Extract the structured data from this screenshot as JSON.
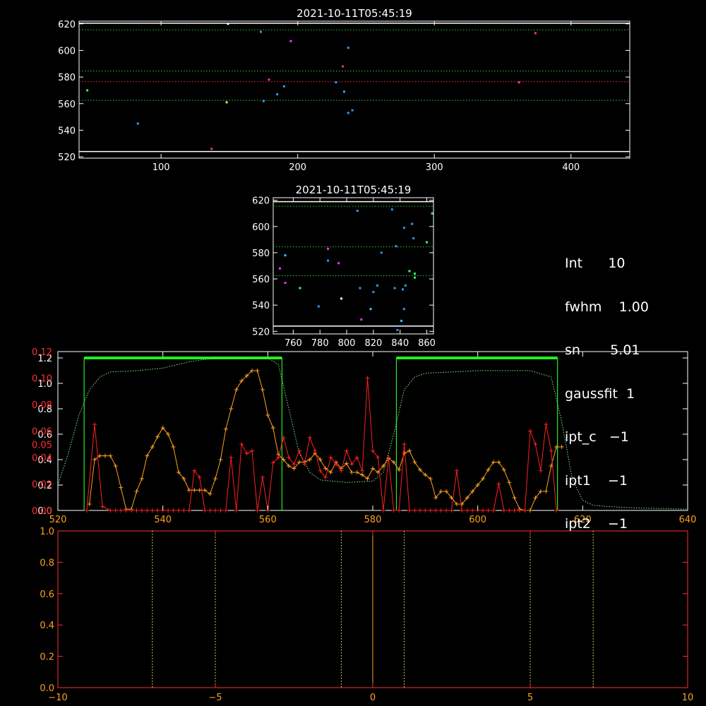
{
  "info_lines": [
    "Int      10",
    "fwhm    1.00",
    "sn       5.01",
    "gaussfit  1",
    "ipt_c   −1",
    "ipt1    −1",
    "ipt2    −1"
  ],
  "chart_data": [
    {
      "type": "scatter",
      "title": "2021-10-11T05:45:19",
      "xlim": [
        40,
        443
      ],
      "ylim": [
        519,
        622
      ],
      "xticks": [
        100,
        200,
        300,
        400
      ],
      "yticks": [
        520,
        540,
        560,
        580,
        600,
        620
      ],
      "hlines": [
        {
          "y": 524,
          "color": "#ffffff",
          "style": "solid"
        },
        {
          "y": 562.5,
          "color": "#2ecc40",
          "style": "dotted"
        },
        {
          "y": 576.5,
          "color": "#ff3030",
          "style": "dotted"
        },
        {
          "y": 584.5,
          "color": "#2ecc40",
          "style": "dotted"
        },
        {
          "y": 615.5,
          "color": "#2ecc40",
          "style": "dotted"
        },
        {
          "y": 620.5,
          "color": "#ffffff",
          "style": "solid"
        }
      ],
      "points": [
        {
          "x": 46,
          "y": 570,
          "color": "#33ff66"
        },
        {
          "x": 83,
          "y": 545,
          "color": "#3399ff"
        },
        {
          "x": 137,
          "y": 526,
          "color": "#ff3366"
        },
        {
          "x": 148,
          "y": 561,
          "color": "#aaff66"
        },
        {
          "x": 149,
          "y": 620,
          "color": "#ffffff"
        },
        {
          "x": 173,
          "y": 614,
          "color": "#3399ff"
        },
        {
          "x": 175,
          "y": 562,
          "color": "#33aaff"
        },
        {
          "x": 179,
          "y": 578,
          "color": "#ff3399"
        },
        {
          "x": 185,
          "y": 567,
          "color": "#3399ff"
        },
        {
          "x": 190,
          "y": 573,
          "color": "#3399ff"
        },
        {
          "x": 195,
          "y": 607,
          "color": "#ff33ff"
        },
        {
          "x": 228,
          "y": 576,
          "color": "#3399ff"
        },
        {
          "x": 233,
          "y": 588,
          "color": "#ff3366"
        },
        {
          "x": 234,
          "y": 569,
          "color": "#33aaff"
        },
        {
          "x": 237,
          "y": 602,
          "color": "#3399ff"
        },
        {
          "x": 237,
          "y": 553,
          "color": "#3399ff"
        },
        {
          "x": 240,
          "y": 555,
          "color": "#3399ff"
        },
        {
          "x": 362,
          "y": 576,
          "color": "#ff3399"
        },
        {
          "x": 374,
          "y": 613,
          "color": "#ff3399"
        }
      ]
    },
    {
      "type": "scatter",
      "title": "2021-10-11T05:45:19",
      "xlim": [
        745,
        865
      ],
      "ylim": [
        518,
        622
      ],
      "xticks": [
        760,
        780,
        800,
        820,
        840,
        860
      ],
      "yticks": [
        520,
        540,
        560,
        580,
        600,
        620
      ],
      "hlines": [
        {
          "y": 524,
          "color": "#ffffff",
          "style": "solid"
        },
        {
          "y": 562.5,
          "color": "#2ecc40",
          "style": "dotted"
        },
        {
          "y": 584.5,
          "color": "#2ecc40",
          "style": "dotted"
        },
        {
          "y": 615.5,
          "color": "#2ecc40",
          "style": "dotted"
        },
        {
          "y": 619,
          "color": "#ffffff",
          "style": "solid"
        }
      ],
      "points": [
        {
          "x": 750,
          "y": 568,
          "color": "#ff33ff"
        },
        {
          "x": 754,
          "y": 578,
          "color": "#33ccff"
        },
        {
          "x": 754,
          "y": 557,
          "color": "#ff33ff"
        },
        {
          "x": 765,
          "y": 553,
          "color": "#33ff66"
        },
        {
          "x": 779,
          "y": 539,
          "color": "#3399ff"
        },
        {
          "x": 786,
          "y": 583,
          "color": "#ff33ff"
        },
        {
          "x": 786,
          "y": 574,
          "color": "#3399ff"
        },
        {
          "x": 794,
          "y": 572,
          "color": "#ff33ff"
        },
        {
          "x": 796,
          "y": 545,
          "color": "#ffffff"
        },
        {
          "x": 808,
          "y": 612,
          "color": "#3399ff"
        },
        {
          "x": 810,
          "y": 553,
          "color": "#3399ff"
        },
        {
          "x": 811,
          "y": 529,
          "color": "#ff33ff"
        },
        {
          "x": 818,
          "y": 537,
          "color": "#33ccff"
        },
        {
          "x": 820,
          "y": 550,
          "color": "#3399ff"
        },
        {
          "x": 823,
          "y": 555,
          "color": "#3399ff"
        },
        {
          "x": 826,
          "y": 580,
          "color": "#3399ff"
        },
        {
          "x": 834,
          "y": 613,
          "color": "#3399ff"
        },
        {
          "x": 836,
          "y": 553,
          "color": "#3399ff"
        },
        {
          "x": 837,
          "y": 585,
          "color": "#3399ff"
        },
        {
          "x": 838,
          "y": 521,
          "color": "#3399ff"
        },
        {
          "x": 841,
          "y": 528,
          "color": "#33ccff"
        },
        {
          "x": 842,
          "y": 552,
          "color": "#3399ff"
        },
        {
          "x": 843,
          "y": 599,
          "color": "#3399ff"
        },
        {
          "x": 843,
          "y": 537,
          "color": "#3399ff"
        },
        {
          "x": 844,
          "y": 555,
          "color": "#3399ff"
        },
        {
          "x": 847,
          "y": 566,
          "color": "#33ff66"
        },
        {
          "x": 849,
          "y": 602,
          "color": "#3399ff"
        },
        {
          "x": 850,
          "y": 591,
          "color": "#3399ff"
        },
        {
          "x": 851,
          "y": 564,
          "color": "#33ff66"
        },
        {
          "x": 851,
          "y": 561,
          "color": "#33ff66"
        },
        {
          "x": 860,
          "y": 588,
          "color": "#33ff66"
        },
        {
          "x": 864,
          "y": 610,
          "color": "#33ff66"
        }
      ]
    },
    {
      "type": "line",
      "xlim": [
        520,
        640
      ],
      "xticks": [
        520,
        540,
        560,
        580,
        600,
        620,
        640
      ],
      "y_left_white": {
        "lim": [
          0,
          1.25
        ],
        "ticks": [
          0.0,
          0.2,
          0.4,
          0.6,
          0.8,
          1.0,
          1.2
        ],
        "tick_labels": [
          "0.0",
          "0.2",
          "0.4",
          "0.6",
          "0.8",
          "1.0",
          "1.2"
        ]
      },
      "y_left_red": {
        "lim": [
          0,
          0.12
        ],
        "ticks": [
          0.0,
          0.02,
          0.04,
          0.05,
          0.06,
          0.08,
          0.1,
          0.12
        ],
        "tick_labels": [
          "0.00",
          "0.02",
          "0.04",
          "0.05",
          "0.06",
          "0.08",
          "0.10",
          "0.12"
        ]
      },
      "bands": [
        {
          "x0": 525,
          "x1": 562.7,
          "height": 1.2
        },
        {
          "x0": 584.5,
          "x1": 615.2,
          "height": 1.2
        }
      ],
      "filter_curve": {
        "color": "#88ee88",
        "x": [
          520,
          522,
          524,
          526,
          528,
          530,
          535,
          540,
          545,
          550,
          555,
          560,
          562,
          564,
          566,
          568,
          570,
          575,
          580,
          582,
          584,
          586,
          588,
          590,
          595,
          600,
          605,
          610,
          614,
          616,
          618,
          620,
          622,
          625,
          630,
          635,
          640
        ],
        "y": [
          0.2,
          0.45,
          0.75,
          0.95,
          1.05,
          1.09,
          1.1,
          1.12,
          1.17,
          1.2,
          1.2,
          1.2,
          1.15,
          0.8,
          0.45,
          0.3,
          0.24,
          0.22,
          0.23,
          0.3,
          0.6,
          0.95,
          1.05,
          1.08,
          1.09,
          1.1,
          1.1,
          1.1,
          1.05,
          0.7,
          0.25,
          0.08,
          0.04,
          0.03,
          0.02,
          0.015,
          0.01
        ]
      },
      "series": [
        {
          "color": "#ffa020",
          "axis": "white",
          "marker": "+",
          "x": [
            526,
            527,
            528,
            529,
            530,
            531,
            532,
            533,
            534,
            535,
            536,
            537,
            538,
            539,
            540,
            541,
            542,
            543,
            544,
            545,
            546,
            547,
            548,
            549,
            550,
            551,
            552,
            553,
            554,
            555,
            556,
            557,
            558,
            559,
            560,
            561,
            562,
            563,
            564,
            565,
            566,
            567,
            568,
            569,
            570,
            571,
            572,
            573,
            574,
            575,
            576,
            577,
            578,
            579,
            580,
            581,
            582,
            583,
            584,
            585,
            586,
            587,
            588,
            589,
            590,
            591,
            592,
            593,
            594,
            595,
            596,
            597,
            598,
            599,
            600,
            601,
            602,
            603,
            604,
            605,
            606,
            607,
            608,
            609,
            610,
            611,
            612,
            613,
            614,
            615,
            616
          ],
          "y": [
            0.05,
            0.4,
            0.43,
            0.43,
            0.43,
            0.35,
            0.18,
            0.01,
            0.01,
            0.15,
            0.25,
            0.43,
            0.5,
            0.58,
            0.65,
            0.6,
            0.5,
            0.3,
            0.25,
            0.16,
            0.16,
            0.16,
            0.16,
            0.13,
            0.25,
            0.4,
            0.64,
            0.8,
            0.95,
            1.02,
            1.06,
            1.1,
            1.1,
            0.95,
            0.75,
            0.65,
            0.44,
            0.4,
            0.35,
            0.33,
            0.38,
            0.38,
            0.4,
            0.45,
            0.4,
            0.33,
            0.3,
            0.38,
            0.33,
            0.37,
            0.3,
            0.3,
            0.28,
            0.25,
            0.33,
            0.3,
            0.35,
            0.41,
            0.38,
            0.32,
            0.45,
            0.47,
            0.38,
            0.32,
            0.28,
            0.25,
            0.1,
            0.15,
            0.15,
            0.1,
            0.05,
            0.05,
            0.1,
            0.15,
            0.2,
            0.25,
            0.32,
            0.38,
            0.38,
            0.32,
            0.22,
            0.1,
            0.01,
            0.0,
            0.0,
            0.1,
            0.15,
            0.15,
            0.35,
            0.5,
            0.5
          ]
        },
        {
          "color": "#ff2020",
          "axis": "red",
          "marker": "+",
          "x": [
            525.5,
            527,
            528.5,
            530,
            531,
            532,
            533,
            534,
            535,
            536,
            537,
            538,
            539,
            540,
            541,
            542,
            543,
            544,
            545,
            546,
            547,
            548,
            549,
            550,
            551,
            552,
            553,
            554,
            555,
            556,
            557,
            558,
            559,
            560,
            561,
            562,
            563,
            564,
            565,
            566,
            567,
            568,
            569,
            570,
            571,
            572,
            573,
            574,
            575,
            576,
            577,
            578,
            579,
            580,
            581,
            582,
            583,
            584,
            585,
            586,
            587,
            588,
            589,
            590,
            591,
            592,
            593,
            594,
            595,
            596,
            597,
            598,
            599,
            600,
            601,
            602,
            603,
            604,
            605,
            606,
            607,
            608,
            609,
            610,
            611,
            612,
            613,
            614,
            615
          ],
          "y": [
            0.0,
            0.065,
            0.003,
            0.0,
            0.0,
            0.0,
            0.0,
            0.0,
            0.0,
            0.0,
            0.0,
            0.0,
            0.0,
            0.0,
            0.0,
            0.0,
            0.0,
            0.0,
            0.0,
            0.03,
            0.025,
            0.0,
            0.0,
            0.0,
            0.0,
            0.0,
            0.04,
            0.0,
            0.05,
            0.043,
            0.045,
            0.0,
            0.025,
            0.0,
            0.036,
            0.04,
            0.055,
            0.04,
            0.035,
            0.045,
            0.035,
            0.055,
            0.045,
            0.03,
            0.025,
            0.04,
            0.035,
            0.03,
            0.045,
            0.035,
            0.04,
            0.03,
            0.1,
            0.045,
            0.04,
            0.0,
            0.04,
            0.0,
            0.0,
            0.05,
            0.0,
            0.0,
            0.0,
            0.0,
            0.0,
            0.0,
            0.0,
            0.0,
            0.0,
            0.03,
            0.0,
            0.0,
            0.0,
            0.0,
            0.0,
            0.0,
            0.0,
            0.02,
            0.0,
            0.0,
            0.0,
            0.0,
            0.0,
            0.06,
            0.05,
            0.03,
            0.065,
            0.045,
            0.0
          ]
        }
      ]
    },
    {
      "type": "line",
      "xlim": [
        -10,
        10
      ],
      "ylim": [
        0,
        1.0
      ],
      "xticks": [
        -10,
        -5,
        0,
        5,
        10
      ],
      "yticks": [
        0.0,
        0.2,
        0.4,
        0.6,
        0.8,
        1.0
      ],
      "tick_labels_x": [
        "−10",
        "−5",
        "0",
        "5",
        "10"
      ],
      "tick_labels_y": [
        "0.0",
        "0.2",
        "0.4",
        "0.6",
        "0.8",
        "1.0"
      ],
      "vlines": [
        {
          "x": -7,
          "color": "#ffff88",
          "style": "dotted"
        },
        {
          "x": -5,
          "color": "#ffff88",
          "style": "dotted"
        },
        {
          "x": -1,
          "color": "#ffff88",
          "style": "dotted"
        },
        {
          "x": 0,
          "color": "#ffa020",
          "style": "solid"
        },
        {
          "x": 1,
          "color": "#ffff88",
          "style": "dotted"
        },
        {
          "x": 5,
          "color": "#ffff88",
          "style": "dotted"
        },
        {
          "x": 7,
          "color": "#ffff88",
          "style": "dotted"
        }
      ]
    }
  ]
}
